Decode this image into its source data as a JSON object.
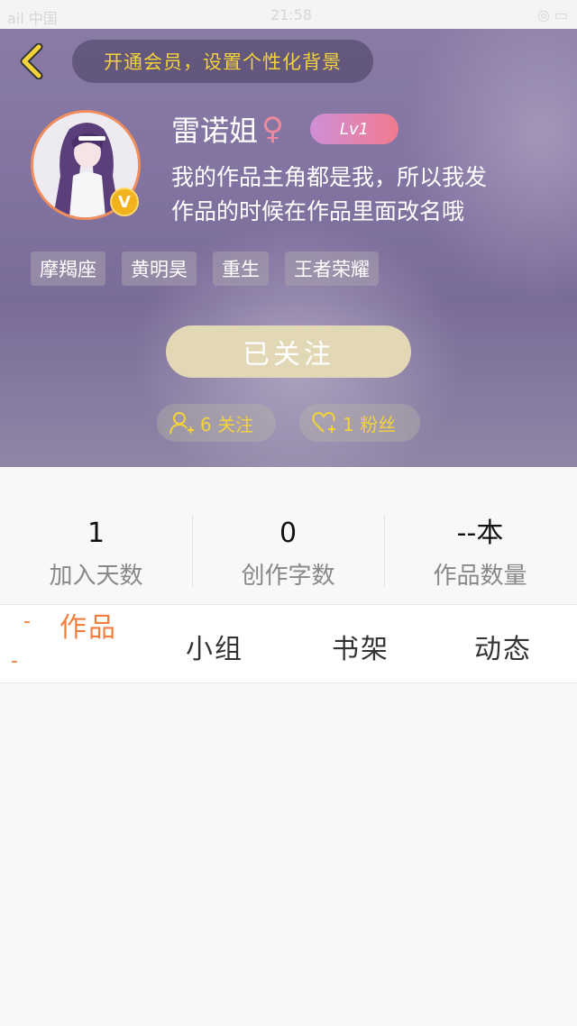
{
  "colors": {
    "accent": "#f07e3e",
    "vip_text": "#f3d33a",
    "follow_button": "#e2d8b5",
    "level_badge_start": "#cf8fd8",
    "level_badge_end": "#f07a8e"
  },
  "status_bar": {
    "left": "ail 中国",
    "time": "21:58",
    "right": "◎ ▭"
  },
  "header": {
    "back_icon": "chevron-left-icon",
    "vip_banner": "开通会员，设置个性化背景",
    "username": "雷诺姐",
    "gender_symbol": "♀",
    "level": "Lv1",
    "badge": "V",
    "bio_line1": "我的作品主角都是我，所以我发",
    "bio_line2": "作品的时候在作品里面改名哦",
    "tags": [
      "摩羯座",
      "黄明昊",
      "重生",
      "王者荣耀"
    ],
    "follow_button": "已关注",
    "following_count": "6 关注",
    "fans_count": "1 粉丝"
  },
  "stats": [
    {
      "value": "1",
      "label": "加入天数"
    },
    {
      "value": "0",
      "label": "创作字数"
    },
    {
      "value": "--本",
      "label": "作品数量"
    }
  ],
  "tabs": {
    "active": "作品",
    "items": [
      "小组",
      "书架",
      "动态"
    ]
  }
}
